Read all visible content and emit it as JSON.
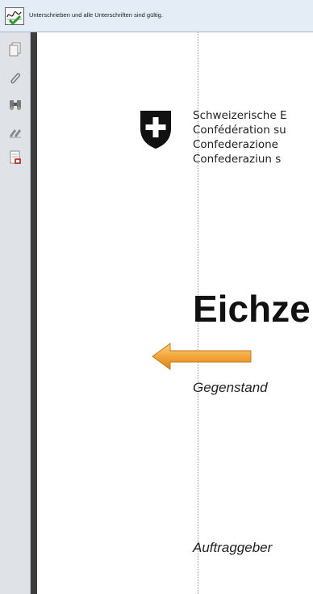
{
  "signature_bar": {
    "message": "Unterschrieben und alle Unterschriften sind gültig."
  },
  "left_toolbar": {
    "tools": [
      "pages-icon",
      "attachment-icon",
      "search-binoculars-icon",
      "signatures-icon",
      "document-properties-icon"
    ]
  },
  "document": {
    "org_lines": [
      "Schweizerische E",
      "Confédération su",
      "Confederazione",
      "Confederaziun s"
    ],
    "heading": "Eichze",
    "field1": "Gegenstand",
    "field2": "Auftraggeber"
  },
  "colors": {
    "arrow": "#f0a030",
    "crest": "#111111"
  }
}
